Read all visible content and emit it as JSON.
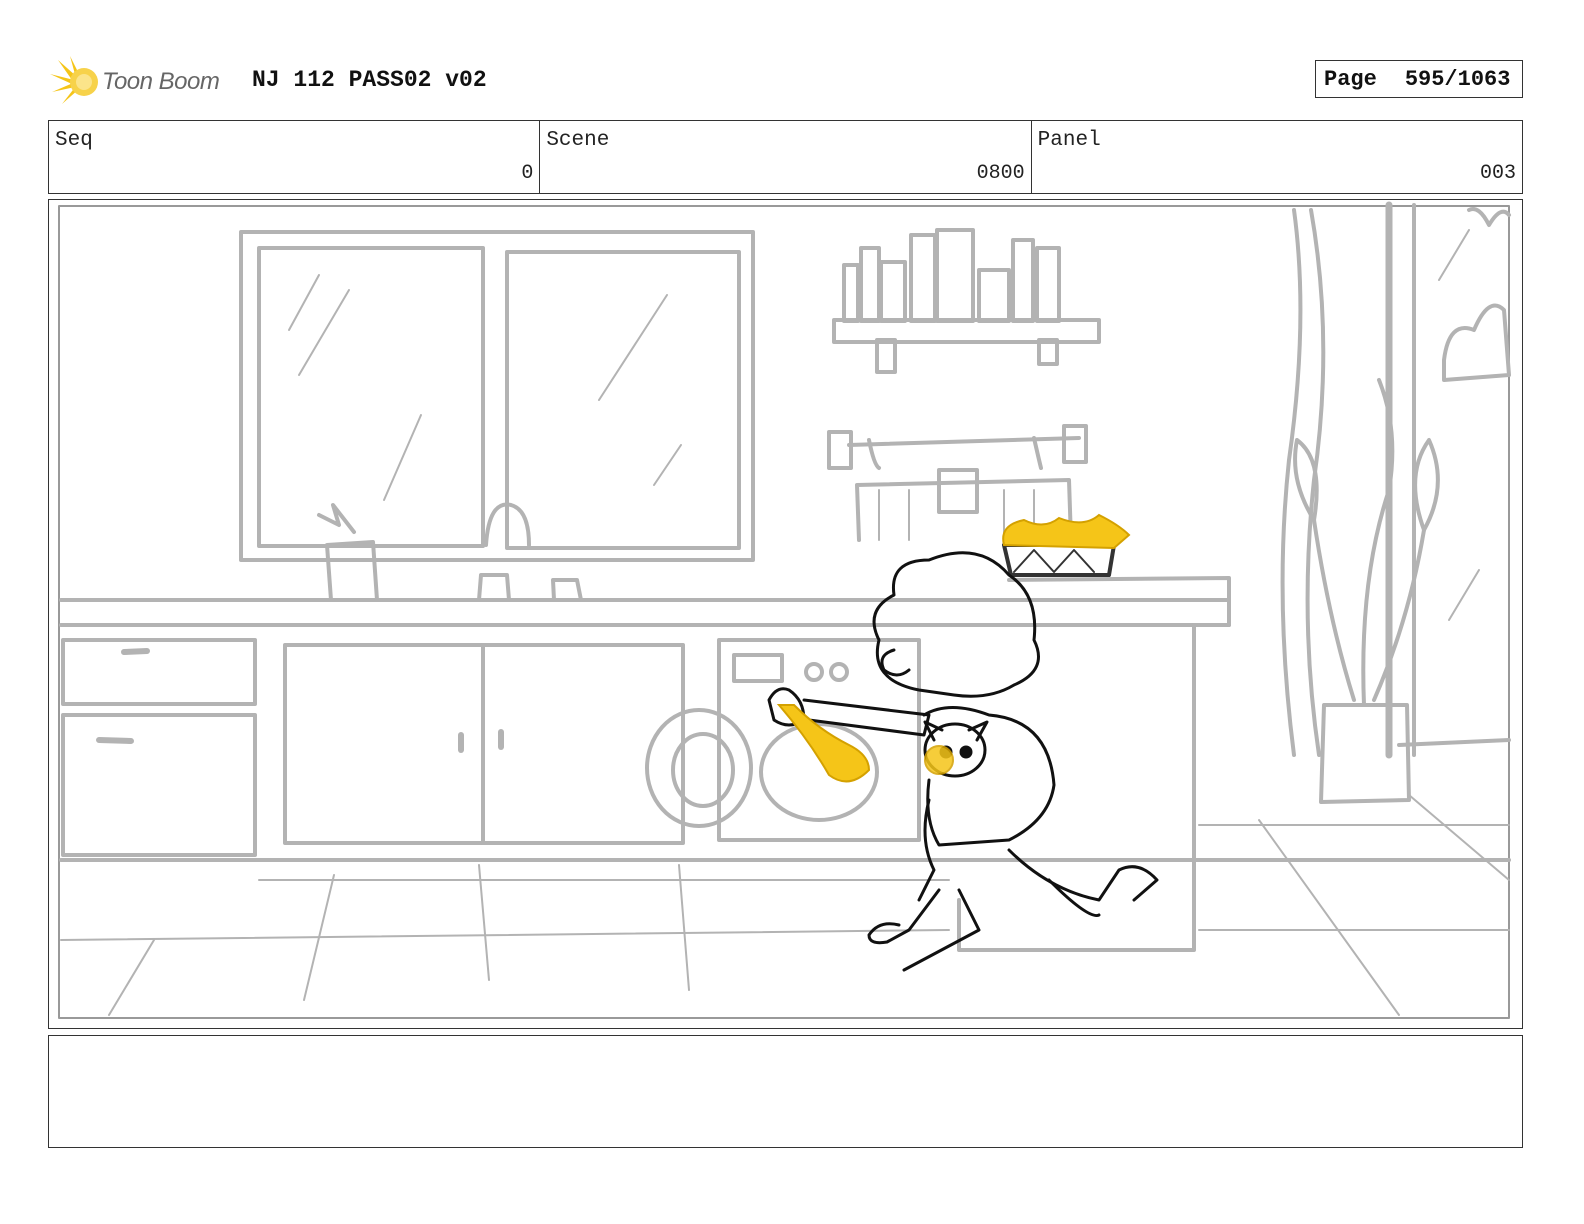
{
  "header": {
    "logo_text": "Toon Boom",
    "title": "NJ 112 PASS02 v02",
    "page_label": "Page",
    "page_value": "595/1063"
  },
  "info": {
    "seq_label": "Seq",
    "seq_value": "0",
    "scene_label": "Scene",
    "scene_value": "0800",
    "panel_label": "Panel",
    "panel_value": "003"
  },
  "colors": {
    "accent_yellow": "#f5c518",
    "sketch_gray": "#b3b3b3",
    "ink": "#111111"
  },
  "icons": {
    "logo": "toon-boom-burst-icon"
  }
}
